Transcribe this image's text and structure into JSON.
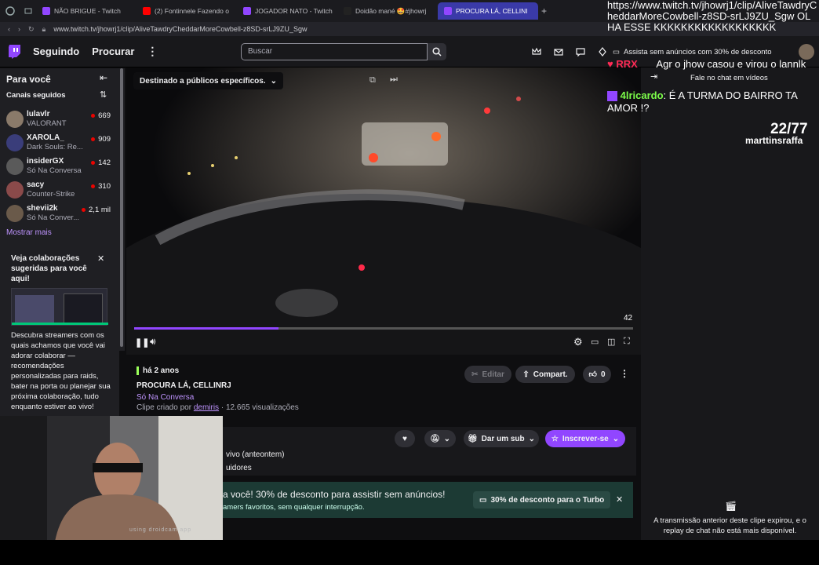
{
  "browser": {
    "tabs": [
      {
        "label": "NÃO BRIGUE - Twitch",
        "color": "#9146ff"
      },
      {
        "label": "(2) Fontinnele Fazendo o",
        "color": "#ff0000"
      },
      {
        "label": "JOGADOR NATO - Twitch",
        "color": "#9146ff"
      },
      {
        "label": "Doidão mané 🤩#jhowrj",
        "color": "#111111"
      },
      {
        "label": "PROCURA LÁ, CELLINI",
        "color": "#9146ff"
      }
    ],
    "url": "www.twitch.tv/jhowrj1/clip/AliveTawdryCheddarMoreCowbell-z8SD-srLJ9ZU_Sgw"
  },
  "nav": {
    "following": "Seguindo",
    "browse": "Procurar",
    "search_placeholder": "Buscar",
    "turbo_promo": "Assista sem anúncios com 30% de desconto"
  },
  "sidebar": {
    "title": "Para você",
    "section": "Canais seguidos",
    "channels": [
      {
        "name": "lulavlr",
        "category": "VALORANT",
        "viewers": "669",
        "color": "#8a7a6a"
      },
      {
        "name": "XAROLA_",
        "category": "Dark Souls: Re...",
        "viewers": "909",
        "color": "#3a3d7a"
      },
      {
        "name": "insiderGX",
        "category": "Só Na Conversa",
        "viewers": "142",
        "color": "#5a5a5a"
      },
      {
        "name": "sacy",
        "category": "Counter-Strike",
        "viewers": "310",
        "color": "#8a4a4a"
      },
      {
        "name": "shevii2k",
        "category": "Só Na Conver...",
        "viewers": "2,1 mil",
        "color": "#6a5a4a"
      }
    ],
    "show_more": "Mostrar mais",
    "collab_title": "Veja colaborações sugeridas para você aqui!",
    "collab_body": "Descubra streamers com os quais achamos que você vai adorar colaborar — recomendações personalizadas para raids, bater na porta ou planejar sua próxima colaboração, tudo enquanto estiver ao vivo!"
  },
  "video": {
    "audience_label": "Destinado a públicos específicos.",
    "time": "42",
    "progress": 0.29
  },
  "clip": {
    "age": "há 2 anos",
    "title": "PROCURA LÁ, CELLINRJ",
    "category": "Só Na Conversa",
    "created_prefix": "Clipe criado por",
    "creator": "demiris",
    "views": "· 12.665 visualizações",
    "edit": "Editar",
    "share": "Compart.",
    "likes": "0"
  },
  "channel": {
    "last_live": "vivo (anteontem)",
    "followers": "uidores",
    "sub": "Dar um sub",
    "follow": "Inscrever-se"
  },
  "promo": {
    "headline": "a você! 30% de desconto para assistir sem anúncios!",
    "sub": "amers favoritos, sem qualquer interrupção.",
    "button": "30% de desconto para o Turbo"
  },
  "chat": {
    "header": "Fale no chat em vídeos",
    "expired": "A transmissão anterior deste clipe expirou, e o replay de chat não está mais disponível."
  },
  "overlay": {
    "msg1": "https://www.twitch.tv/jhowrj1/clip/AliveTawdryCheddarMoreCowbell-z8SD-srLJ9ZU_Sgw OLHA ESSE KKKKKKKKKKKKKKKKKK",
    "user2": "RRX",
    "msg2": "Agr o jhow casou e virou o lannlk",
    "user3": "4lricardo",
    "msg3": "É A TURMA DO BAIRRO TA AMOR !?",
    "goal": "22/77",
    "goal_user": "marttinsraffa"
  },
  "webcam": {
    "watermark": "using droidcam app"
  }
}
